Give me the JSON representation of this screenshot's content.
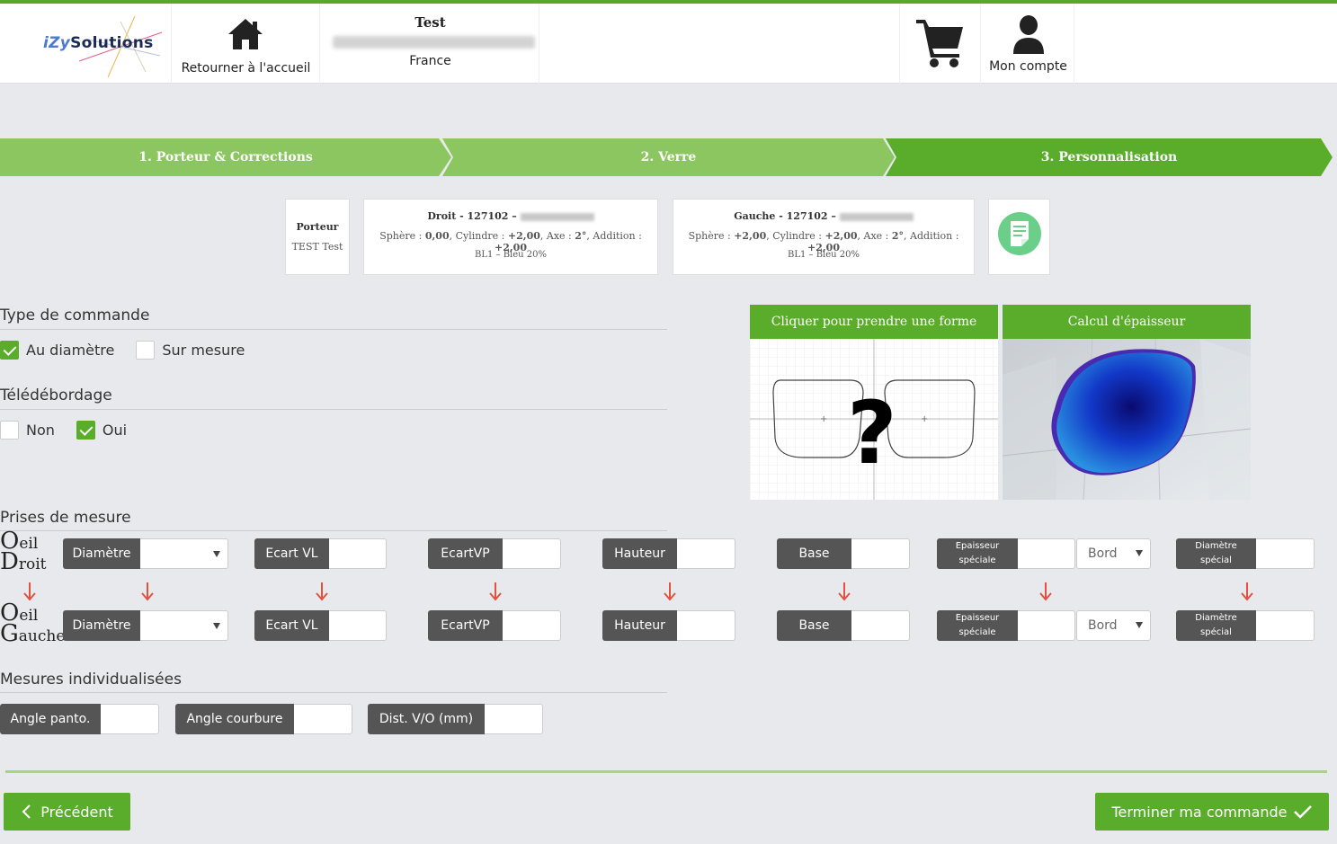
{
  "header": {
    "logo_text_prefix": "iZy",
    "logo_text_suffix": "Solutions",
    "home_label": "Retourner à l'accueil",
    "store_name": "Test",
    "store_country": "France",
    "account_label": "Mon compte"
  },
  "steps": [
    {
      "label": "1. Porteur & Corrections"
    },
    {
      "label": "2. Verre"
    },
    {
      "label": "3. Personnalisation"
    }
  ],
  "cards": {
    "porteur_title": "Porteur",
    "porteur_name": "TEST Test",
    "droit_title": "Droit - 127102 –",
    "droit_line_prefix_1": "Sphère : ",
    "droit_sphere": "0,00",
    "droit_line_2": ", Cylindre : ",
    "droit_cyl": "+2,00",
    "droit_line_3": ", Axe : ",
    "droit_axe": "2°",
    "droit_line_4": ", Addition : ",
    "droit_add": "+2,00",
    "droit_lens": "BL1 – Bleu 20%",
    "gauche_title": "Gauche - 127102 –",
    "gauche_line_prefix_1": "Sphère : ",
    "gauche_sphere": "+2,00",
    "gauche_line_2": ", Cylindre : ",
    "gauche_cyl": "+2,00",
    "gauche_line_3": ", Axe : ",
    "gauche_axe": "2°",
    "gauche_line_4": ", Addition : ",
    "gauche_add": "+2,00",
    "gauche_lens": "BL1 – Bleu 20%"
  },
  "type_commande": {
    "title": "Type de commande",
    "options": [
      {
        "label": "Au diamètre",
        "checked": true
      },
      {
        "label": "Sur mesure",
        "checked": false
      }
    ]
  },
  "teledebordage": {
    "title": "Télédébordage",
    "options": [
      {
        "label": "Non",
        "checked": false
      },
      {
        "label": "Oui",
        "checked": true
      }
    ]
  },
  "panels": {
    "shape_title": "Cliquer pour prendre une forme",
    "shape_symbol": "?",
    "calc_title": "Calcul d'épaisseur"
  },
  "prises": {
    "title": "Prises de mesure",
    "droit_big": "O",
    "droit_small1": "eil",
    "droit_big2": "D",
    "droit_small2": "roit",
    "gauche_big": "O",
    "gauche_small1": "eil",
    "gauche_big2": "G",
    "gauche_small2": "auche",
    "diametre": "Diamètre",
    "ecart_vl": "Ecart VL",
    "ecart_vp": "EcartVP",
    "hauteur": "Hauteur",
    "base": "Base",
    "epaisseur_l1": "Epaisseur",
    "epaisseur_l2": "spéciale",
    "bord": "Bord",
    "diam_special_l1": "Diamètre",
    "diam_special_l2": "spécial"
  },
  "mesures": {
    "title": "Mesures individualisées",
    "angle_panto": "Angle panto.",
    "angle_courbure": "Angle courbure",
    "dist_vo": "Dist. V/O (mm)"
  },
  "footer": {
    "prev_label": "Précédent",
    "finish_label": "Terminer ma commande"
  },
  "colors": {
    "accent": "#5aac2b",
    "accent_light": "#8cc660",
    "label_bg": "#555555",
    "arrow": "#e0513f"
  }
}
